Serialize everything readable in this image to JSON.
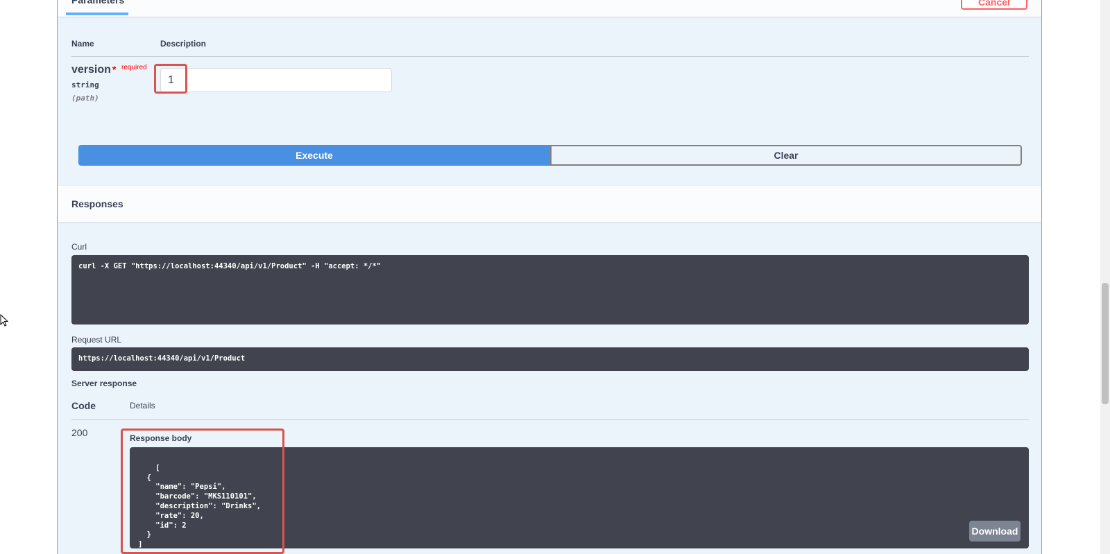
{
  "parameters": {
    "tab_label": "Parameters",
    "cancel_label": "Cancel",
    "col_name": "Name",
    "col_description": "Description",
    "param": {
      "name": "version",
      "required_star": "*",
      "required_text": "required",
      "type": "string",
      "location": "(path)",
      "value": "1"
    }
  },
  "actions": {
    "execute_label": "Execute",
    "clear_label": "Clear"
  },
  "responses": {
    "title": "Responses",
    "curl_label": "Curl",
    "curl_command": "curl -X GET \"https://localhost:44340/api/v1/Product\" -H \"accept: */*\"",
    "request_url_label": "Request URL",
    "request_url": "https://localhost:44340/api/v1/Product",
    "server_response_label": "Server response",
    "col_code": "Code",
    "col_details": "Details",
    "status_code": "200",
    "response_body_label": "Response body",
    "response_body": "[\n  {\n    \"name\": \"Pepsi\",\n    \"barcode\": \"MKS110101\",\n    \"description\": \"Drinks\",\n    \"rate\": 20,\n    \"id\": 2\n  }\n]",
    "download_label": "Download"
  },
  "colors": {
    "accent": "#61affe",
    "execute": "#4990e2",
    "highlight": "#d9534f",
    "code_bg": "#41444e"
  }
}
